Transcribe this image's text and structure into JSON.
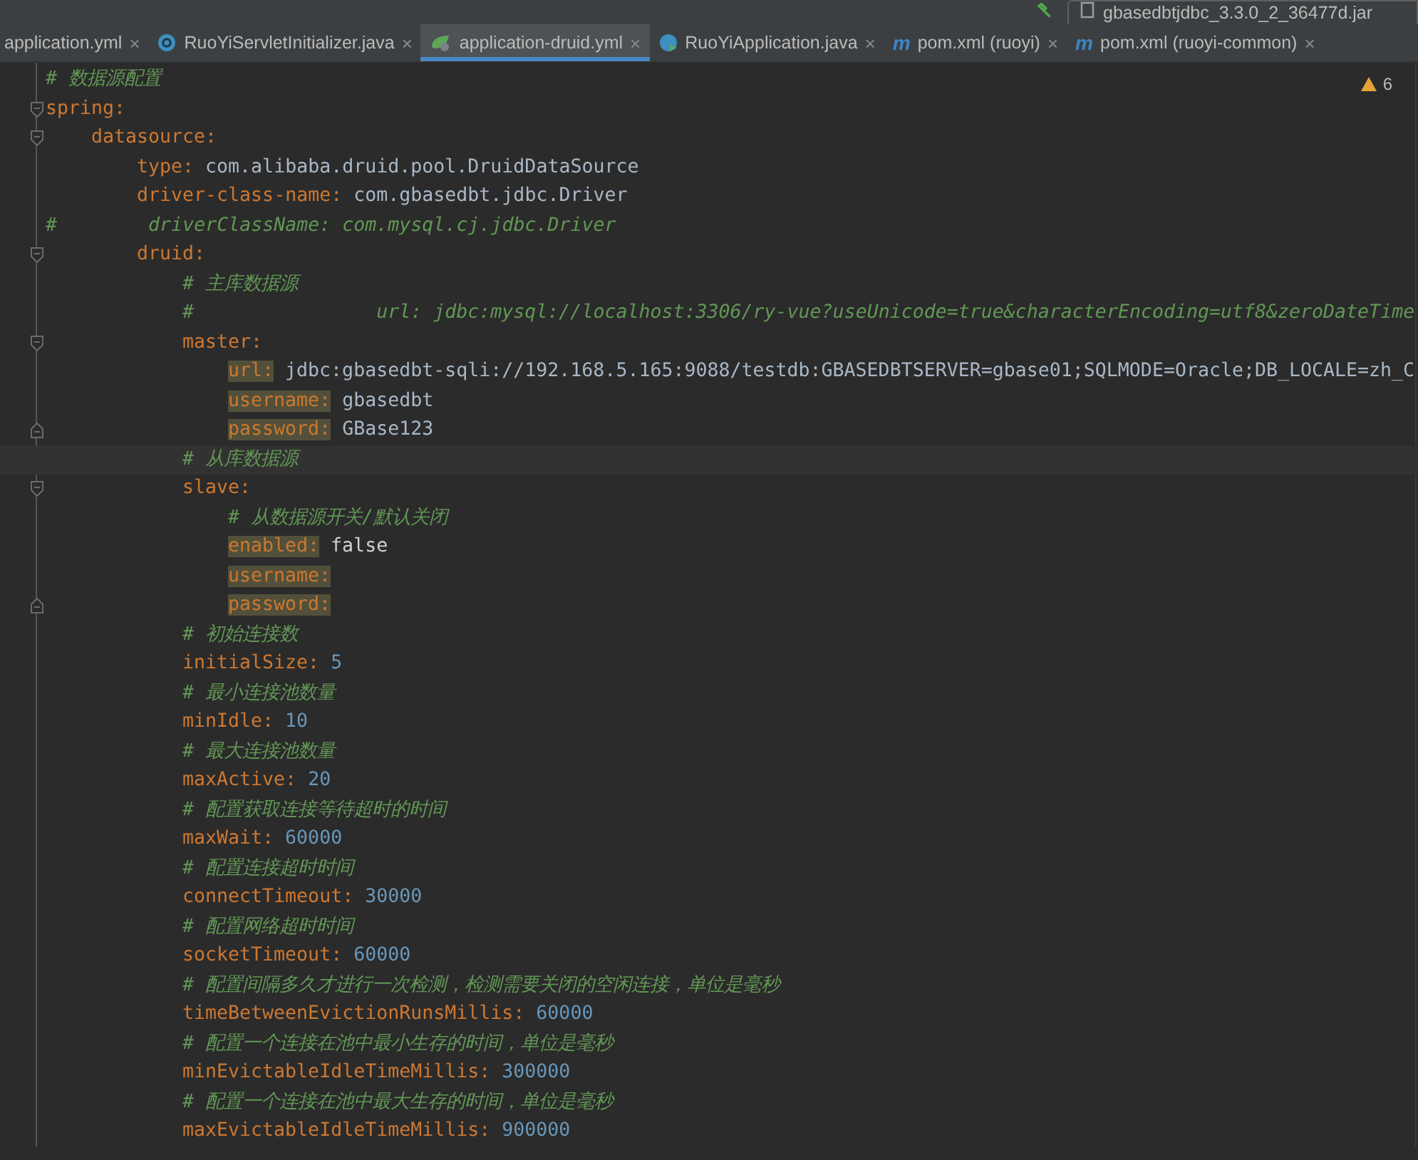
{
  "toolbar": {
    "run_config": "gbasedbtjdbc_3.3.0_2_36477d.jar"
  },
  "tabs": [
    {
      "label": "application.yml",
      "kind": "none",
      "close": "×",
      "selected": false
    },
    {
      "label": "RuoYiServletInitializer.java",
      "kind": "class",
      "close": "×",
      "selected": false
    },
    {
      "label": "application-druid.yml",
      "kind": "spring",
      "close": "×",
      "selected": true
    },
    {
      "label": "RuoYiApplication.java",
      "kind": "main",
      "close": "×",
      "selected": false
    },
    {
      "label": "pom.xml (ruoyi)",
      "kind": "maven",
      "icon_letter": "m",
      "close": "×",
      "selected": false
    },
    {
      "label": "pom.xml (ruoyi-common)",
      "kind": "maven",
      "icon_letter": "m",
      "close": "×",
      "selected": false
    }
  ],
  "inspections": {
    "warnings": "6"
  },
  "lines": [
    {
      "kind": "comment",
      "text": "# 数据源配置",
      "current": false
    },
    {
      "kind": "pair",
      "key": "spring:",
      "highlighted": false,
      "current": false,
      "children": [
        {
          "kind": "pair",
          "key": "datasource:",
          "highlighted": false,
          "current": false,
          "children": [
            {
              "kind": "pair",
              "key": "type:",
              "value": {
                "kind": "text",
                "text": "com.alibaba.druid.pool.DruidDataSource"
              },
              "highlighted": false,
              "current": false
            },
            {
              "kind": "pair",
              "key": "driver-class-name:",
              "value": {
                "kind": "text",
                "text": "com.gbasedbt.jdbc.Driver"
              },
              "highlighted": false,
              "current": false
            },
            {
              "kind": "flush_comment",
              "text": "#        driverClassName: com.mysql.cj.jdbc.Driver",
              "current": false
            },
            {
              "kind": "pair",
              "key": "druid:",
              "highlighted": false,
              "current": false,
              "children": [
                {
                  "kind": "comment",
                  "text": "# 主库数据源",
                  "current": false
                },
                {
                  "kind": "comment",
                  "text": "#                url: jdbc:mysql://localhost:3306/ry-vue?useUnicode=true&characterEncoding=utf8&zeroDateTime",
                  "current": false
                },
                {
                  "kind": "pair",
                  "key": "master:",
                  "highlighted": false,
                  "current": false,
                  "children": [
                    {
                      "kind": "pair",
                      "key": "url:",
                      "value": {
                        "kind": "text",
                        "text": "jdbc:gbasedbt-sqli://192.168.5.165:9088/testdb:GBASEDBTSERVER=gbase01;SQLMODE=Oracle;DB_LOCALE=zh_C"
                      },
                      "highlighted": true,
                      "current": false,
                      "fold_end": false
                    },
                    {
                      "kind": "pair",
                      "key": "username:",
                      "value": {
                        "kind": "text",
                        "text": "gbasedbt"
                      },
                      "highlighted": true,
                      "current": false,
                      "fold_end": false
                    },
                    {
                      "kind": "pair",
                      "key": "password:",
                      "value": {
                        "kind": "text",
                        "text": "GBase123"
                      },
                      "highlighted": true,
                      "current": false,
                      "fold_end": true
                    }
                  ]
                },
                {
                  "kind": "comment",
                  "text": "# 从库数据源",
                  "current": true
                },
                {
                  "kind": "pair",
                  "key": "slave:",
                  "highlighted": false,
                  "current": false,
                  "children": [
                    {
                      "kind": "comment",
                      "text": "# 从数据源开关/默认关闭",
                      "current": false,
                      "fold_end": false
                    },
                    {
                      "kind": "pair",
                      "key": "enabled:",
                      "value": {
                        "kind": "bool",
                        "text": "false"
                      },
                      "highlighted": true,
                      "current": false,
                      "fold_end": false
                    },
                    {
                      "kind": "pair",
                      "key": "username:",
                      "highlighted": true,
                      "current": false,
                      "fold_end": false
                    },
                    {
                      "kind": "pair",
                      "key": "password:",
                      "highlighted": true,
                      "current": false,
                      "fold_end": true
                    }
                  ]
                },
                {
                  "kind": "comment",
                  "text": "# 初始连接数",
                  "current": false
                },
                {
                  "kind": "pair",
                  "key": "initialSize:",
                  "value": {
                    "kind": "number",
                    "text": "5"
                  },
                  "highlighted": false,
                  "current": false
                },
                {
                  "kind": "comment",
                  "text": "# 最小连接池数量",
                  "current": false
                },
                {
                  "kind": "pair",
                  "key": "minIdle:",
                  "value": {
                    "kind": "number",
                    "text": "10"
                  },
                  "highlighted": false,
                  "current": false
                },
                {
                  "kind": "comment",
                  "text": "# 最大连接池数量",
                  "current": false
                },
                {
                  "kind": "pair",
                  "key": "maxActive:",
                  "value": {
                    "kind": "number",
                    "text": "20"
                  },
                  "highlighted": false,
                  "current": false
                },
                {
                  "kind": "comment",
                  "text": "# 配置获取连接等待超时的时间",
                  "current": false
                },
                {
                  "kind": "pair",
                  "key": "maxWait:",
                  "value": {
                    "kind": "number",
                    "text": "60000"
                  },
                  "highlighted": false,
                  "current": false
                },
                {
                  "kind": "comment",
                  "text": "# 配置连接超时时间",
                  "current": false
                },
                {
                  "kind": "pair",
                  "key": "connectTimeout:",
                  "value": {
                    "kind": "number",
                    "text": "30000"
                  },
                  "highlighted": false,
                  "current": false
                },
                {
                  "kind": "comment",
                  "text": "# 配置网络超时时间",
                  "current": false
                },
                {
                  "kind": "pair",
                  "key": "socketTimeout:",
                  "value": {
                    "kind": "number",
                    "text": "60000"
                  },
                  "highlighted": false,
                  "current": false
                },
                {
                  "kind": "comment",
                  "text": "# 配置间隔多久才进行一次检测，检测需要关闭的空闲连接，单位是毫秒",
                  "current": false
                },
                {
                  "kind": "pair",
                  "key": "timeBetweenEvictionRunsMillis:",
                  "value": {
                    "kind": "number",
                    "text": "60000"
                  },
                  "highlighted": false,
                  "current": false
                },
                {
                  "kind": "comment",
                  "text": "# 配置一个连接在池中最小生存的时间，单位是毫秒",
                  "current": false
                },
                {
                  "kind": "pair",
                  "key": "minEvictableIdleTimeMillis:",
                  "value": {
                    "kind": "number",
                    "text": "300000"
                  },
                  "highlighted": false,
                  "current": false
                },
                {
                  "kind": "comment",
                  "text": "# 配置一个连接在池中最大生存的时间，单位是毫秒",
                  "current": false
                },
                {
                  "kind": "pair",
                  "key": "maxEvictableIdleTimeMillis:",
                  "value": {
                    "kind": "number",
                    "text": "900000"
                  },
                  "highlighted": false,
                  "current": false
                }
              ]
            }
          ]
        }
      ]
    }
  ]
}
